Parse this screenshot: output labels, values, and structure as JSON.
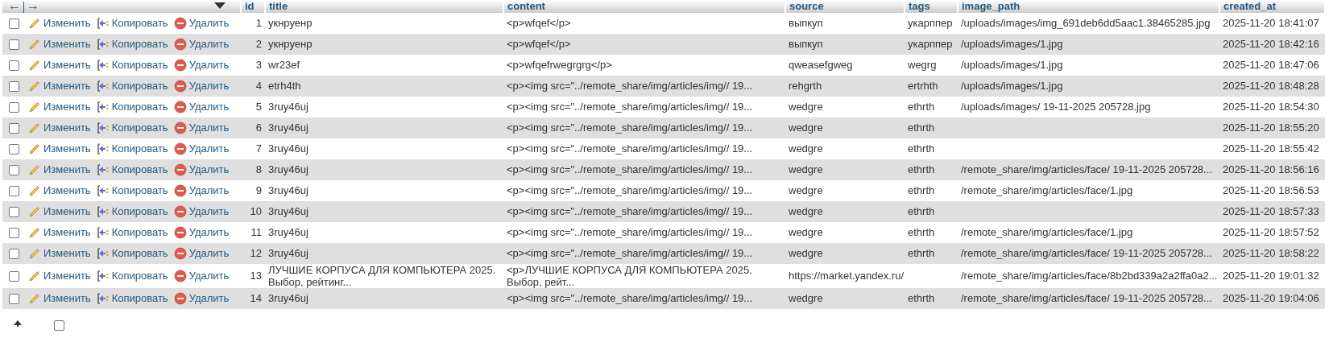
{
  "footer": {
    "select_all_checked": false
  },
  "header": {
    "nav_left": "←",
    "nav_right": "→",
    "columns": [
      "id",
      "title",
      "content",
      "source",
      "tags",
      "image_path",
      "created_at"
    ]
  },
  "rows": [
    {
      "checked": false,
      "edit": "Изменить",
      "copy": "Копировать",
      "delete": "Удалить",
      "cells": [
        "1",
        "укнруенр",
        "<p>wfqef</p>",
        "выпкуп",
        "укарппер",
        "/uploads/images/img_691deb6dd5aac1.38465285.jpg",
        "2025-11-20 18:41:07"
      ]
    },
    {
      "checked": false,
      "edit": "Изменить",
      "copy": "Копировать",
      "delete": "Удалить",
      "cells": [
        "2",
        "укнруенр",
        "<p>wfqef</p>",
        "выпкуп",
        "укарппер",
        "/uploads/images/1.jpg",
        "2025-11-20 18:42:16"
      ]
    },
    {
      "checked": false,
      "edit": "Изменить",
      "copy": "Копировать",
      "delete": "Удалить",
      "cells": [
        "3",
        "wr23ef",
        "<p>wfqefrwegrgrg</p>",
        "qweasefgweg",
        "wegrg",
        "/uploads/images/1.jpg",
        "2025-11-20 18:47:06"
      ]
    },
    {
      "checked": false,
      "edit": "Изменить",
      "copy": "Копировать",
      "delete": "Удалить",
      "cells": [
        "4",
        "etrh4th",
        "<p><img src=\"../remote_share/img/articles/img// 19...",
        "rehgrth",
        "ertrhth",
        "/uploads/images/1.jpg",
        "2025-11-20 18:48:28"
      ]
    },
    {
      "checked": false,
      "edit": "Изменить",
      "copy": "Копировать",
      "delete": "Удалить",
      "cells": [
        "5",
        "3ruy46uj",
        "<p><img src=\"../remote_share/img/articles/img// 19...",
        "wedgre",
        "ethrth",
        "/uploads/images/ 19-11-2025 205728.jpg",
        "2025-11-20 18:54:30"
      ]
    },
    {
      "checked": false,
      "edit": "Изменить",
      "copy": "Копировать",
      "delete": "Удалить",
      "cells": [
        "6",
        "3ruy46uj",
        "<p><img src=\"../remote_share/img/articles/img// 19...",
        "wedgre",
        "ethrth",
        "",
        "2025-11-20 18:55:20"
      ]
    },
    {
      "checked": false,
      "edit": "Изменить",
      "copy": "Копировать",
      "delete": "Удалить",
      "cells": [
        "7",
        "3ruy46uj",
        "<p><img src=\"../remote_share/img/articles/img// 19...",
        "wedgre",
        "ethrth",
        "",
        "2025-11-20 18:55:42"
      ]
    },
    {
      "checked": false,
      "edit": "Изменить",
      "copy": "Копировать",
      "delete": "Удалить",
      "cells": [
        "8",
        "3ruy46uj",
        "<p><img src=\"../remote_share/img/articles/img// 19...",
        "wedgre",
        "ethrth",
        "/remote_share/img/articles/face/ 19-11-2025 205728...",
        "2025-11-20 18:56:16"
      ]
    },
    {
      "checked": false,
      "edit": "Изменить",
      "copy": "Копировать",
      "delete": "Удалить",
      "cells": [
        "9",
        "3ruy46uj",
        "<p><img src=\"../remote_share/img/articles/img// 19...",
        "wedgre",
        "ethrth",
        "/remote_share/img/articles/face/1.jpg",
        "2025-11-20 18:56:53"
      ]
    },
    {
      "checked": false,
      "edit": "Изменить",
      "copy": "Копировать",
      "delete": "Удалить",
      "cells": [
        "10",
        "3ruy46uj",
        "<p><img src=\"../remote_share/img/articles/img// 19...",
        "wedgre",
        "ethrth",
        "",
        "2025-11-20 18:57:33"
      ]
    },
    {
      "checked": false,
      "edit": "Изменить",
      "copy": "Копировать",
      "delete": "Удалить",
      "cells": [
        "11",
        "3ruy46uj",
        "<p><img src=\"../remote_share/img/articles/img// 19...",
        "wedgre",
        "ethrth",
        "/remote_share/img/articles/face/1.jpg",
        "2025-11-20 18:57:52"
      ]
    },
    {
      "checked": false,
      "edit": "Изменить",
      "copy": "Копировать",
      "delete": "Удалить",
      "cells": [
        "12",
        "3ruy46uj",
        "<p><img src=\"../remote_share/img/articles/img// 19...",
        "wedgre",
        "ethrth",
        "/remote_share/img/articles/face/ 19-11-2025 205728...",
        "2025-11-20 18:58:22"
      ]
    },
    {
      "checked": false,
      "edit": "Изменить",
      "copy": "Копировать",
      "delete": "Удалить",
      "cells": [
        "13",
        "ЛУЧШИЕ КОРПУСА ДЛЯ КОМПЬЮТЕРА 2025. Выбор, рейтинг...",
        "<p>ЛУЧШИЕ КОРПУСА ДЛЯ КОМПЬЮТЕРА 2025. Выбор, рейт...",
        "https://market.yandex.ru/",
        "",
        "/remote_share/img/articles/face/8b2bd339a2a2ffa0a2...",
        "2025-11-20 19:01:32"
      ]
    },
    {
      "checked": false,
      "edit": "Изменить",
      "copy": "Копировать",
      "delete": "Удалить",
      "cells": [
        "14",
        "3ruy46uj",
        "<p><img src=\"../remote_share/img/articles/img// 19...",
        "wedgre",
        "ethrth",
        "/remote_share/img/articles/face/ 19-11-2025 205728...",
        "2025-11-20 19:04:06"
      ]
    }
  ]
}
